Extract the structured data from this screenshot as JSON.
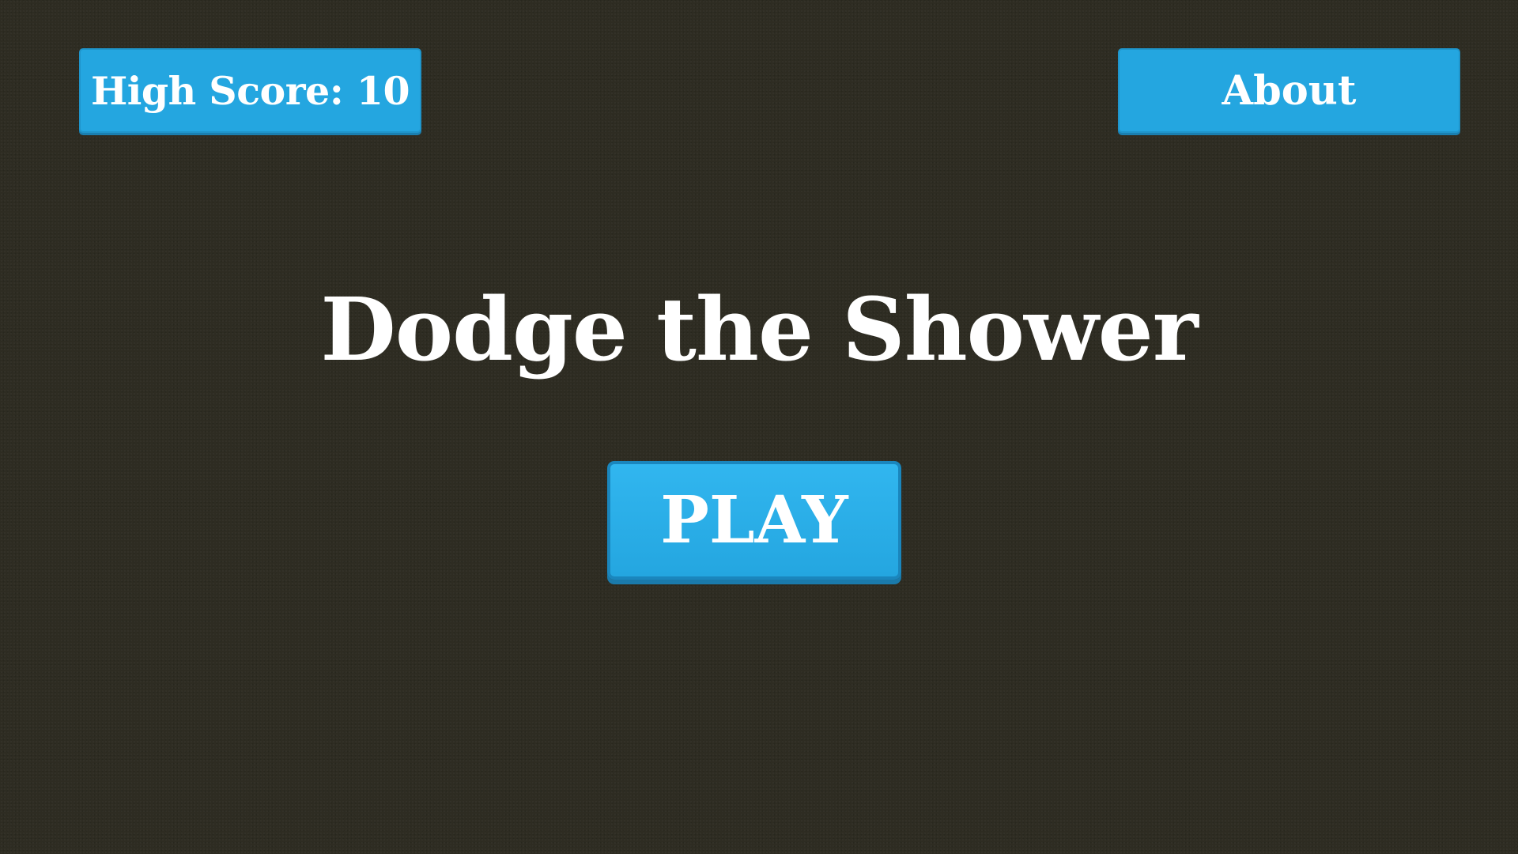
{
  "header": {
    "high_score_label": "High Score: 10",
    "about_label": "About"
  },
  "main": {
    "title": "Dodge the Shower",
    "play_label": "PLAY"
  },
  "colors": {
    "background": "#2e2c22",
    "button": "#24a6e0",
    "text": "#ffffff"
  }
}
